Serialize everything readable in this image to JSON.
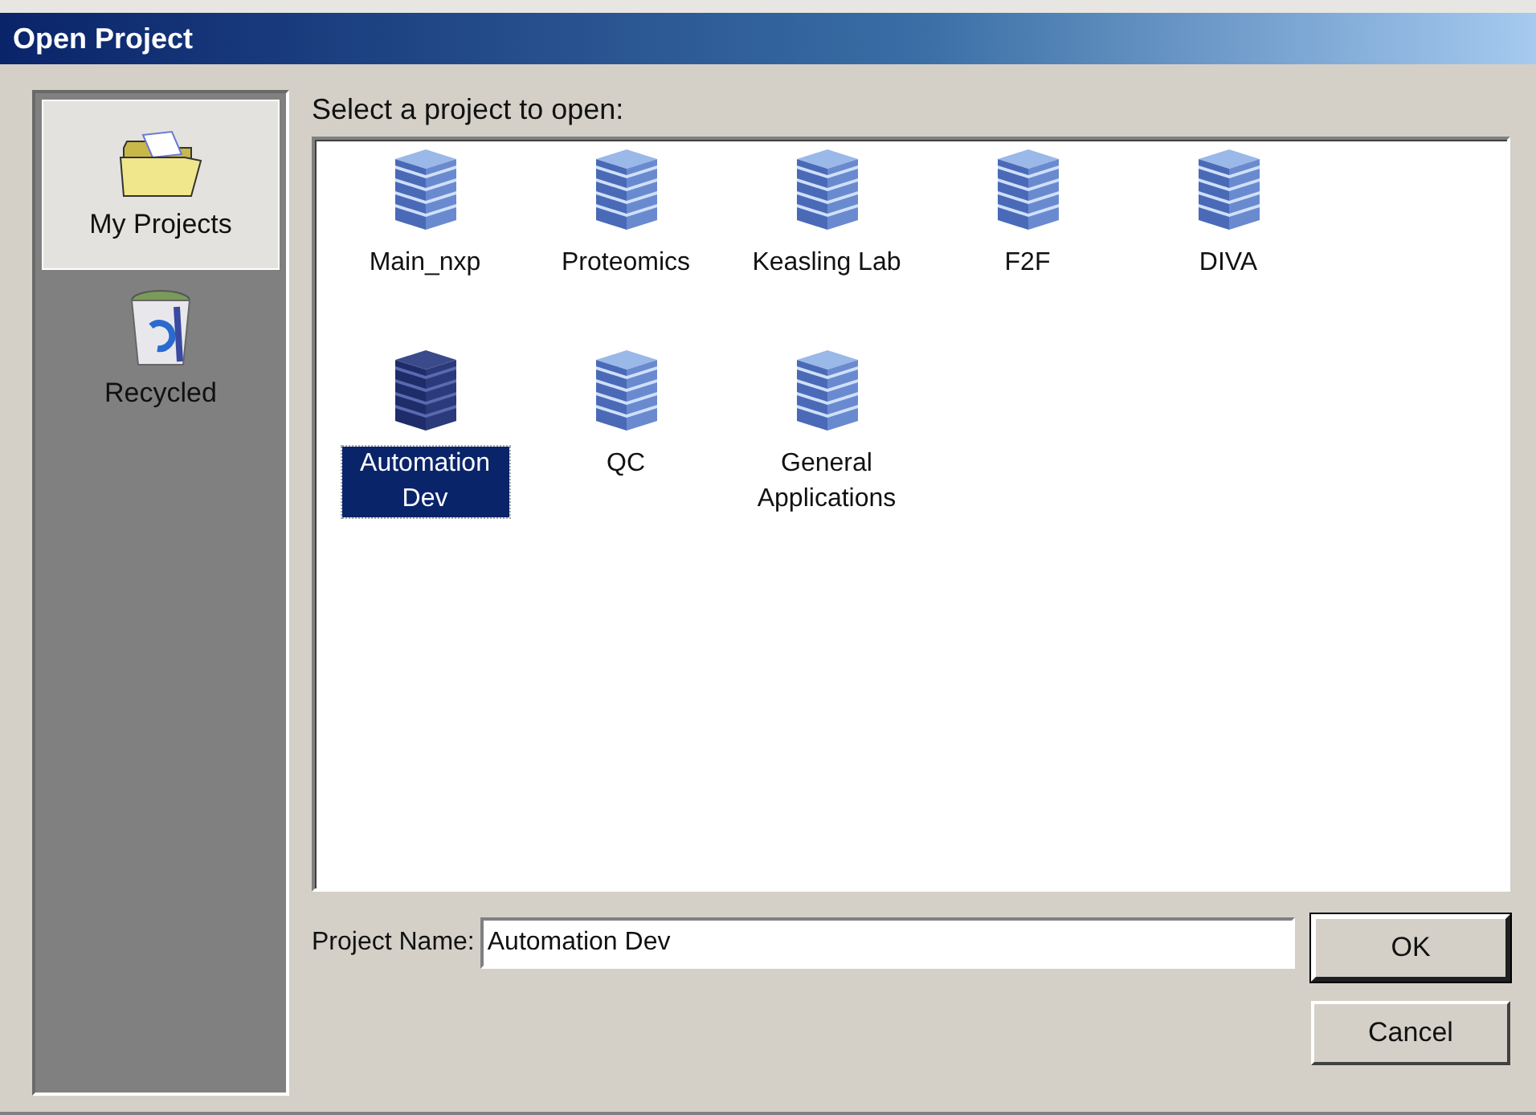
{
  "window": {
    "title": "Open Project"
  },
  "sidebar": {
    "items": [
      {
        "label": "My Projects",
        "kind": "folder",
        "selected": true
      },
      {
        "label": "Recycled",
        "kind": "bin",
        "selected": false
      }
    ]
  },
  "prompt": "Select a project to open:",
  "projects": [
    {
      "label": "Main_nxp",
      "selected": false
    },
    {
      "label": "Proteomics",
      "selected": false
    },
    {
      "label": "Keasling Lab",
      "selected": false
    },
    {
      "label": "F2F",
      "selected": false
    },
    {
      "label": "DIVA",
      "selected": false
    },
    {
      "label": "Automation Dev",
      "selected": true
    },
    {
      "label": "QC",
      "selected": false
    },
    {
      "label": "General Applications",
      "selected": false
    }
  ],
  "project_name": {
    "label": "Project Name:",
    "value": "Automation Dev"
  },
  "buttons": [
    {
      "label": "OK",
      "default": true
    },
    {
      "label": "Cancel",
      "default": false
    }
  ]
}
